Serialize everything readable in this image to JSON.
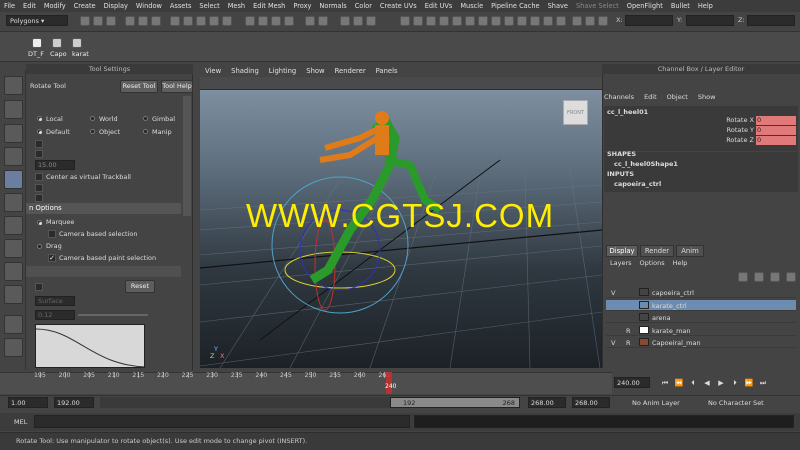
{
  "menu": [
    "File",
    "Edit",
    "Modify",
    "Create",
    "Display",
    "Window",
    "Assets",
    "Select",
    "Mesh",
    "Edit Mesh",
    "Proxy",
    "Normals",
    "Color",
    "Create UVs",
    "Edit UVs",
    "Muscle",
    "Pipeline Cache",
    "Shave",
    "Shave Select",
    "OpenFlight",
    "Bullet",
    "Help"
  ],
  "status": {
    "mode": "Polygons",
    "coord_x": "X:",
    "coord_y": "Y:",
    "coord_z": "Z:"
  },
  "shelf": {
    "tab1": "DT_F",
    "tab2": "Capo",
    "tab3": "karat"
  },
  "tool_settings": {
    "header": "Tool Settings",
    "title": "Rotate Tool",
    "reset_tool": "Reset Tool",
    "tool_help": "Tool Help",
    "local": "Local",
    "world": "World",
    "gimbal": "Gimbal",
    "default": "Default",
    "object": "Object",
    "manip": "Manip",
    "step_value": "15.00",
    "trackball": "Center as virtual Trackball",
    "options_section": "n Options",
    "marquee": "Marquee",
    "camera_based_selection": "Camera based selection",
    "drag": "Drag",
    "camera_based_paint": "Camera based paint selection",
    "check_mark": "✓",
    "reset": "Reset",
    "surface": "Surface",
    "falloff_value": "0.12"
  },
  "viewport": {
    "menu": [
      "View",
      "Shading",
      "Lighting",
      "Show",
      "Renderer",
      "Panels"
    ],
    "watermark": "WWW.CGTSJ.COM",
    "cube_label": "FRONT",
    "axis_x": "X",
    "axis_y": "Y",
    "axis_z": "Z"
  },
  "channel_box": {
    "header": "Channel Box / Layer Editor",
    "menu": [
      "Channels",
      "Edit",
      "Object",
      "Show"
    ],
    "node": "cc_l_heel01",
    "attrs": [
      {
        "label": "Rotate X",
        "value": "0"
      },
      {
        "label": "Rotate Y",
        "value": "0"
      },
      {
        "label": "Rotate Z",
        "value": "0"
      }
    ],
    "shapes_label": "SHAPES",
    "shape_node": "cc_l_heel0Shape1",
    "inputs_label": "INPUTS",
    "input_node": "capoeira_ctrl"
  },
  "layer_editor": {
    "tabs": [
      "Display",
      "Render",
      "Anim"
    ],
    "menu": [
      "Layers",
      "Options",
      "Help"
    ],
    "layers": [
      {
        "v": "V",
        "p": "",
        "color": "",
        "name": "capoeira_ctrl"
      },
      {
        "v": "",
        "p": "",
        "color": "",
        "name": "karate_ctrl"
      },
      {
        "v": "",
        "p": "",
        "color": "",
        "name": "arena"
      },
      {
        "v": "",
        "p": "R",
        "color": "#ffffff",
        "name": "karate_man"
      },
      {
        "v": "V",
        "p": "R",
        "color": "#8a4a32",
        "name": "Capoeiral_man"
      }
    ]
  },
  "timeline": {
    "ticks": [
      "195",
      "200",
      "205",
      "210",
      "215",
      "220",
      "225",
      "230",
      "235",
      "240",
      "245",
      "250",
      "255",
      "260",
      "265"
    ],
    "current_frame": "240",
    "current_field": "240.00"
  },
  "range": {
    "start": "1.00",
    "start_inner": "192.00",
    "range_start": "192",
    "range_end": "268",
    "end_inner": "268.00",
    "end": "268.00",
    "anim_layer": "No Anim Layer",
    "char_set": "No Character Set"
  },
  "mel": {
    "label": "MEL"
  },
  "help_line": "Rotate Tool: Use manipulator to rotate object(s). Use edit mode to change pivot (INSERT).",
  "colors": {
    "selection": "#6c8cb0",
    "watermark": "#ffee00",
    "attr_bg": "#e07a7a",
    "timeline_marker": "#c03030"
  }
}
